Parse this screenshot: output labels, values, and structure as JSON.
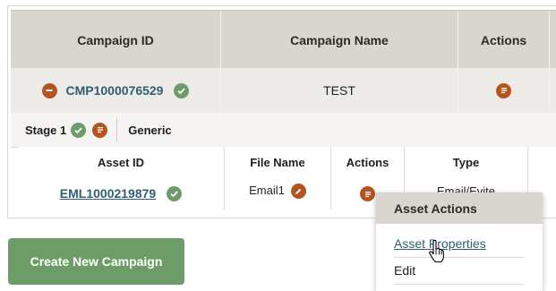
{
  "campaigns_table": {
    "headers": {
      "id": "Campaign ID",
      "name": "Campaign Name",
      "actions": "Actions"
    },
    "row": {
      "id": "CMP1000076529",
      "name": "TEST"
    }
  },
  "stage": {
    "label": "Stage 1",
    "type": "Generic"
  },
  "assets_table": {
    "headers": {
      "id": "Asset ID",
      "file_name": "File Name",
      "actions": "Actions",
      "type": "Type"
    },
    "row": {
      "id": "EML1000219879",
      "file_name": "Email1",
      "type": "Email/Evite"
    }
  },
  "create_button": {
    "label": "Create New Campaign"
  },
  "asset_actions_menu": {
    "title": "Asset Actions",
    "items": [
      {
        "label": "Asset Properties"
      },
      {
        "label": "Edit"
      }
    ]
  },
  "colors": {
    "accent_red": "#b4541f",
    "accent_green": "#6d9c6a",
    "link": "#2f5f6f",
    "header_bg": "#d9d6cf"
  },
  "icons": [
    "collapse-minus-icon",
    "check-icon",
    "actions-menu-icon",
    "edit-pencil-icon",
    "hand-pointer-icon"
  ]
}
